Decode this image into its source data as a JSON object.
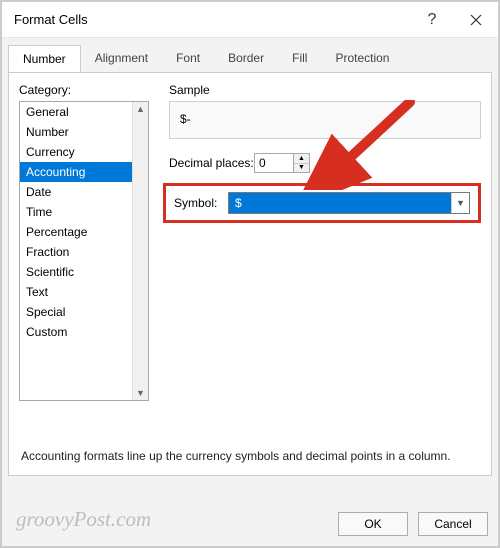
{
  "title": "Format Cells",
  "tabs": [
    "Number",
    "Alignment",
    "Font",
    "Border",
    "Fill",
    "Protection"
  ],
  "active_tab": 0,
  "category_label": "Category:",
  "categories": [
    "General",
    "Number",
    "Currency",
    "Accounting",
    "Date",
    "Time",
    "Percentage",
    "Fraction",
    "Scientific",
    "Text",
    "Special",
    "Custom"
  ],
  "selected_category_index": 3,
  "sample_label": "Sample",
  "sample_value": "$-",
  "decimal_label": "Decimal places:",
  "decimal_value": "0",
  "symbol_label": "Symbol:",
  "symbol_value": "$",
  "description": "Accounting formats line up the currency symbols and decimal points in a column.",
  "buttons": {
    "ok": "OK",
    "cancel": "Cancel"
  },
  "watermark": "groovyPost.com",
  "highlight_color": "#d62e1f"
}
